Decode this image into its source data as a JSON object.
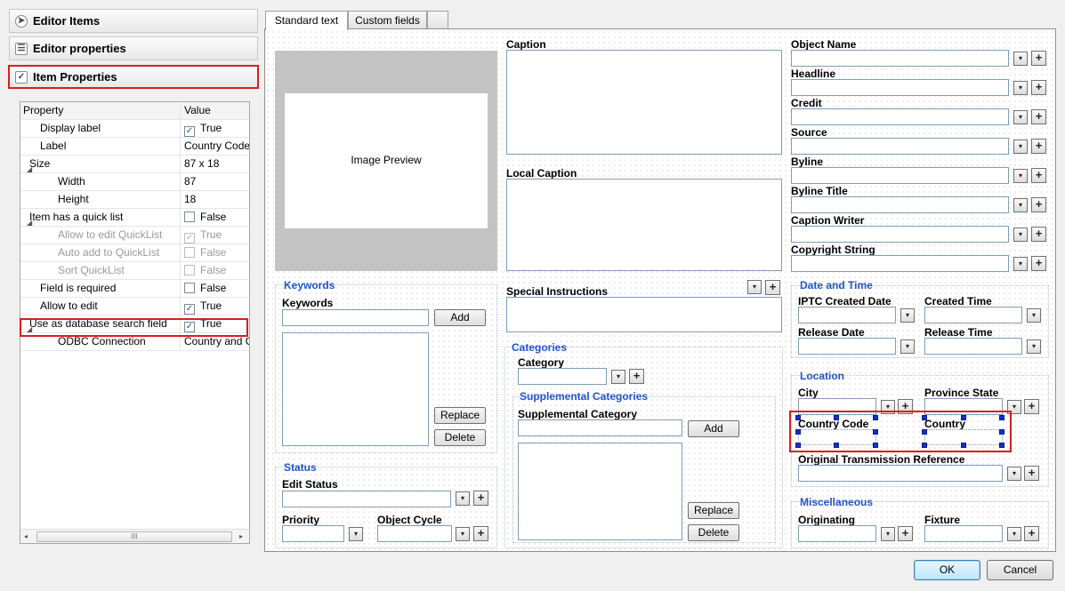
{
  "panels": {
    "editor_items": "Editor Items",
    "editor_properties": "Editor properties",
    "item_properties": "Item Properties"
  },
  "property_grid": {
    "col_property": "Property",
    "col_value": "Value",
    "rows": [
      {
        "label": "Display label",
        "value": "True",
        "checked": true
      },
      {
        "label": "Label",
        "value": "Country Code"
      },
      {
        "label": "Size",
        "value": "87 x 18",
        "expander": "◢"
      },
      {
        "label": "Width",
        "value": "87"
      },
      {
        "label": "Height",
        "value": "18"
      },
      {
        "label": "Item has a quick list",
        "value": "False",
        "checked": false,
        "expander": "◢"
      },
      {
        "label": "Allow to edit QuickList",
        "value": "True",
        "checked": true
      },
      {
        "label": "Auto add to QuickList",
        "value": "False",
        "checked": false
      },
      {
        "label": "Sort QuickList",
        "value": "False",
        "checked": false
      },
      {
        "label": "Field is required",
        "value": "False",
        "checked": false
      },
      {
        "label": "Allow to edit",
        "value": "True",
        "checked": true
      },
      {
        "label": "Use as database search field",
        "value": "True",
        "checked": true,
        "expander": "◢"
      },
      {
        "label": "ODBC Connection",
        "value": "Country and C"
      }
    ],
    "scroll_thumb": "III"
  },
  "tabs": [
    "Standard text",
    "Custom fields"
  ],
  "preview": {
    "label": "Image Preview"
  },
  "keywords": {
    "group": "Keywords",
    "label": "Keywords",
    "add": "Add",
    "replace": "Replace",
    "delete": "Delete"
  },
  "status": {
    "group": "Status",
    "edit_status": "Edit Status",
    "priority": "Priority",
    "object_cycle": "Object Cycle"
  },
  "caption": {
    "caption": "Caption",
    "local_caption": "Local Caption",
    "special_instructions": "Special Instructions"
  },
  "categories": {
    "group": "Categories",
    "category": "Category",
    "supp_group": "Supplemental Categories",
    "supp_label": "Supplemental Category",
    "add": "Add",
    "replace": "Replace",
    "delete": "Delete"
  },
  "right_fields": [
    "Object Name",
    "Headline",
    "Credit",
    "Source",
    "Byline",
    "Byline Title",
    "Caption Writer",
    "Copyright String"
  ],
  "datetime": {
    "group": "Date and Time",
    "iptc_created_date": "IPTC Created Date",
    "created_time": "Created Time",
    "release_date": "Release Date",
    "release_time": "Release Time"
  },
  "location": {
    "group": "Location",
    "city": "City",
    "province_state": "Province State",
    "country_code": "Country Code",
    "country": "Country",
    "otr": "Original Transmission Reference"
  },
  "misc": {
    "group": "Miscellaneous",
    "originating": "Originating",
    "fixture": "Fixture"
  },
  "glyphs": {
    "dropdown": "▾",
    "plus": "+",
    "check": "✓",
    "left": "◂",
    "right": "▸"
  },
  "footer": {
    "ok": "OK",
    "cancel": "Cancel"
  },
  "colors": {
    "accent": "#2255cc",
    "highlight": "#d61f1f",
    "selection": "#1030d0"
  }
}
